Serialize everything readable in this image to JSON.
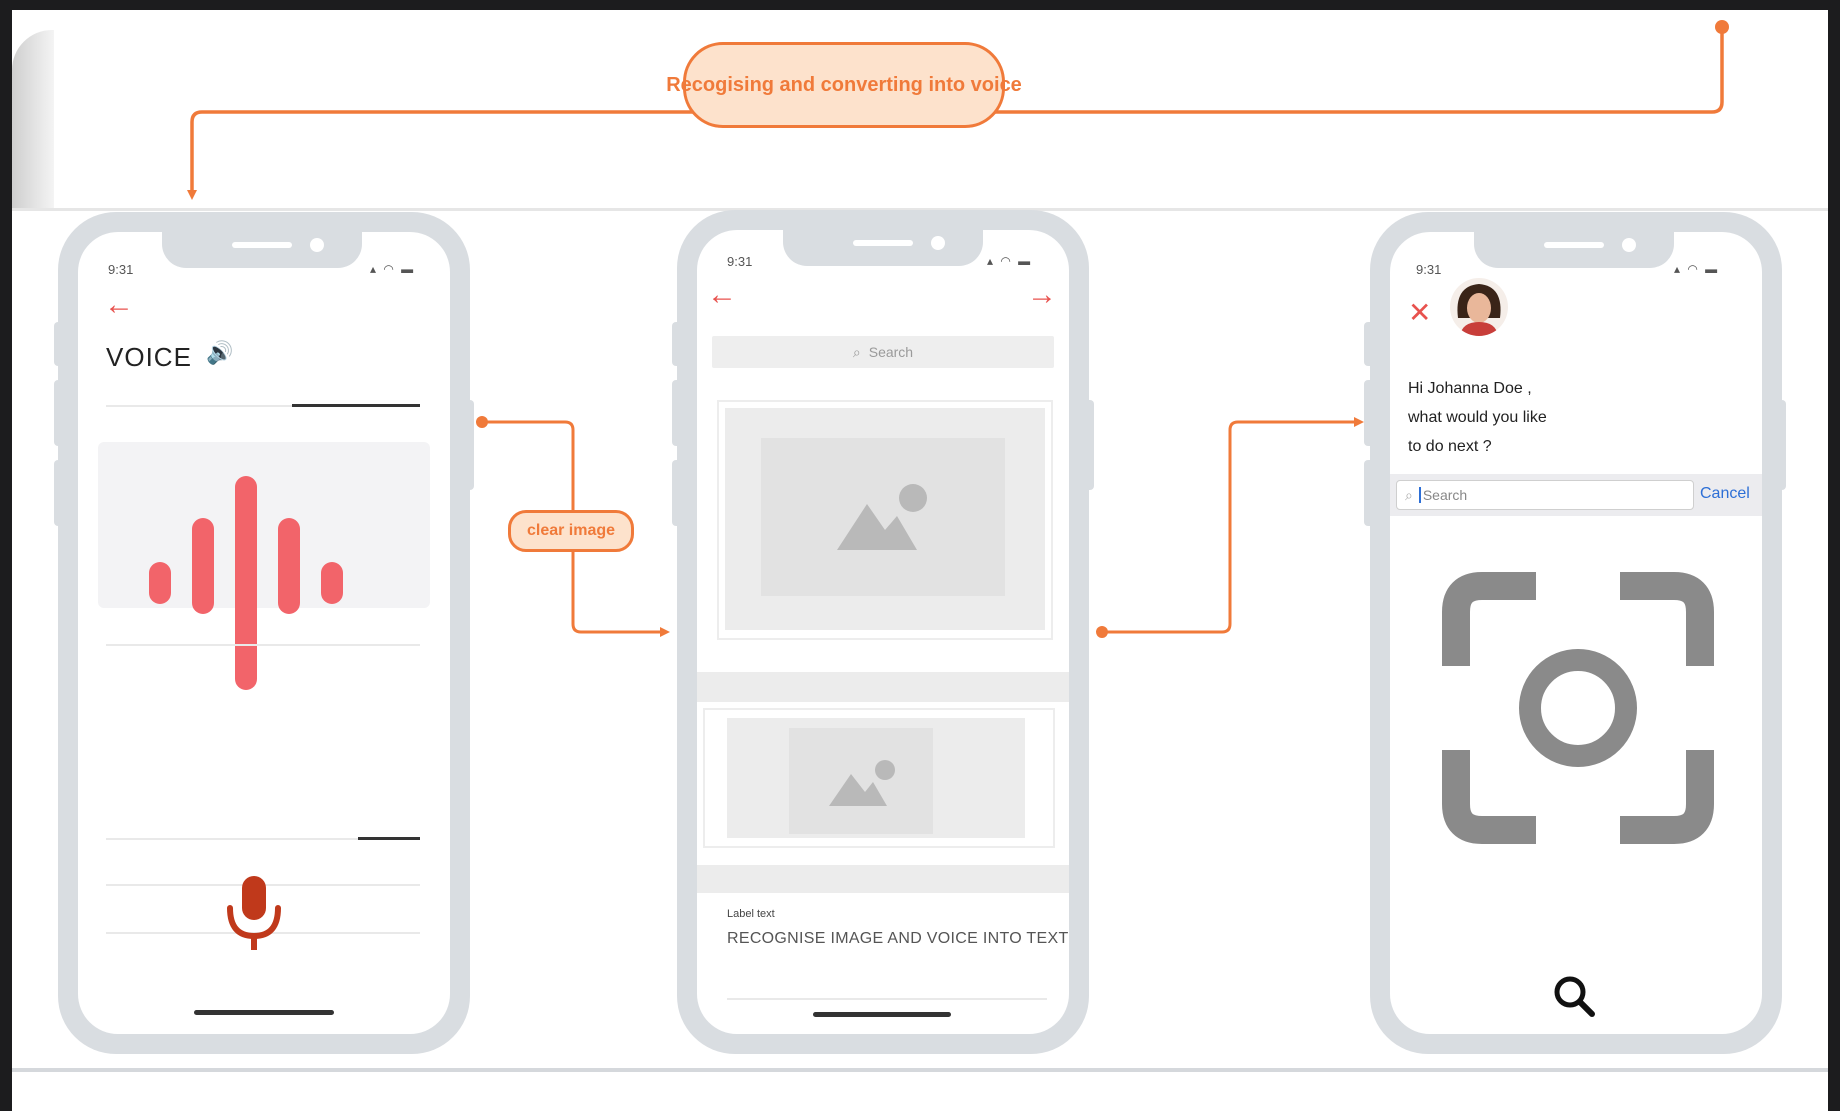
{
  "flow": {
    "top_label": "Recogising and  converting into voice",
    "mid_label": "clear image"
  },
  "colors": {
    "connector": "#f07a3a",
    "accent_red": "#e8524e",
    "wave": "#f2646a",
    "mic": "#c0391b",
    "phone_frame": "#d9dde1",
    "link_blue": "#2d6fd6"
  },
  "phone1": {
    "time": "9:31",
    "back_icon": "arrow-left-icon",
    "title": "VOICE",
    "speaker_icon": "speaker-icon",
    "mic_icon": "microphone-icon"
  },
  "phone2": {
    "time": "9:31",
    "back_icon": "arrow-left-icon",
    "forward_icon": "arrow-right-icon",
    "search_placeholder": "Search",
    "label_small": "Label text",
    "label_text": "RECOGNISE IMAGE AND  VOICE INTO TEXT"
  },
  "phone3": {
    "time": "9:31",
    "close_icon": "close-icon",
    "greeting": [
      "Hi Johanna Doe ,",
      "what would you like",
      "to do next ?"
    ],
    "search_placeholder": "Search",
    "cancel_label": "Cancel",
    "scan_icon": "camera-scan-icon",
    "search_icon": "magnifier-icon"
  }
}
